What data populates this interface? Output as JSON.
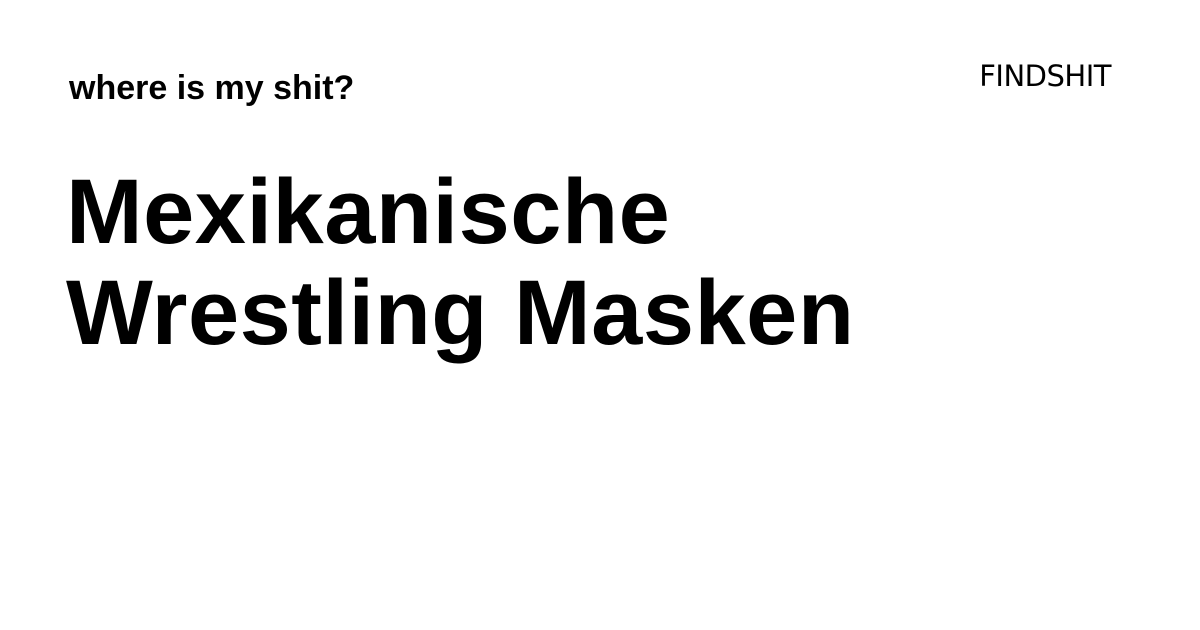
{
  "header": {
    "tagline": "where is my shit?",
    "logo_text": "FINDSHIT"
  },
  "main": {
    "title_lines": [
      "Mexikanische",
      "Wrestling Masken"
    ]
  },
  "colors": {
    "background": "#ffffff",
    "text": "#000000"
  }
}
